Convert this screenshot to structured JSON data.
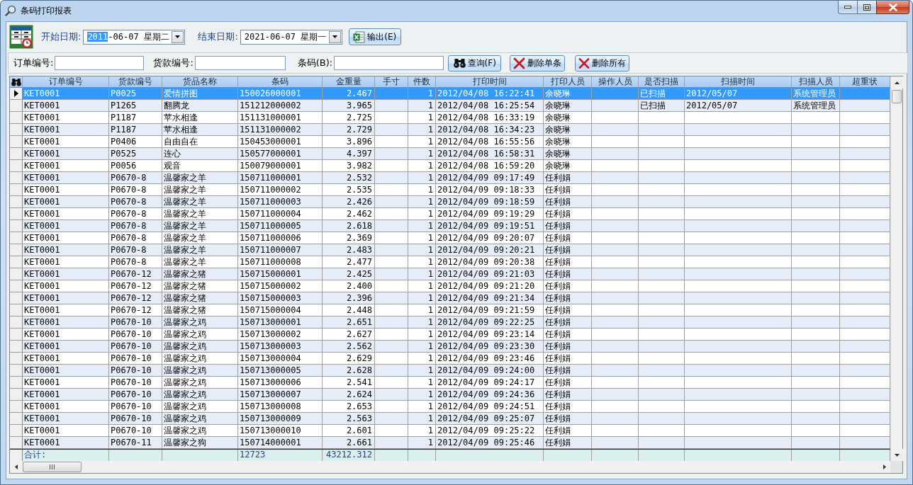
{
  "window": {
    "title": "条码打印报表"
  },
  "toolbar": {
    "start_date": {
      "label": "开始日期:",
      "year": "2011",
      "rest": "-06-07 星期二",
      "year_selected": true
    },
    "end_date": {
      "label": "结束日期:",
      "year": "2021",
      "rest": "-06-07 星期一",
      "year_selected": false
    },
    "export_button": "输出(E)"
  },
  "search": {
    "fields": [
      {
        "label": "订单编号:"
      },
      {
        "label": "货款编号:"
      },
      {
        "label": "条码(B):"
      }
    ],
    "buttons": [
      {
        "kind": "search",
        "label": "查询(F)"
      },
      {
        "kind": "delete",
        "label": "删除单条"
      },
      {
        "kind": "delete",
        "label": "删除所有"
      }
    ]
  },
  "table": {
    "columns": [
      "订单编号",
      "货款编号",
      "货品名称",
      "条码",
      "金重量",
      "手寸",
      "件数",
      "打印时间",
      "打印人员",
      "操作人员",
      "是否扫描",
      "扫描时间",
      "扫描人员",
      "超重状"
    ],
    "rows": [
      {
        "selected": true,
        "order_no": "KET0001",
        "item_no": "P0025",
        "item_name": "爱情拼图",
        "barcode": "150026000001",
        "gold_weight": "2.467",
        "qty": "1",
        "print_time": "2012/04/08 16:22:41",
        "printer": "余晓琳",
        "scanned": "已扫描",
        "scan_time": "2012/05/07",
        "scanner": "系统管理员"
      },
      {
        "selected": false,
        "order_no": "KET0001",
        "item_no": "P1265",
        "item_name": "翻腾龙",
        "barcode": "151212000002",
        "gold_weight": "3.965",
        "qty": "1",
        "print_time": "2012/04/08 16:25:54",
        "printer": "余晓琳",
        "scanned": "已扫描",
        "scan_time": "2012/05/07",
        "scanner": "系统管理员"
      },
      {
        "selected": false,
        "order_no": "KET0001",
        "item_no": "P1187",
        "item_name": "苹水相逢",
        "barcode": "151131000001",
        "gold_weight": "2.725",
        "qty": "1",
        "print_time": "2012/04/08 16:33:19",
        "printer": "余晓琳"
      },
      {
        "selected": false,
        "order_no": "KET0001",
        "item_no": "P1187",
        "item_name": "苹水相逢",
        "barcode": "151131000002",
        "gold_weight": "2.729",
        "qty": "1",
        "print_time": "2012/04/08 16:34:23",
        "printer": "余晓琳"
      },
      {
        "selected": false,
        "order_no": "KET0001",
        "item_no": "P0406",
        "item_name": "自由自在",
        "barcode": "150453000001",
        "gold_weight": "3.896",
        "qty": "1",
        "print_time": "2012/04/08 16:55:56",
        "printer": "余晓琳"
      },
      {
        "selected": false,
        "order_no": "KET0001",
        "item_no": "P0525",
        "item_name": "连心",
        "barcode": "150577000001",
        "gold_weight": "4.397",
        "qty": "1",
        "print_time": "2012/04/08 16:58:31",
        "printer": "余晓琳"
      },
      {
        "selected": false,
        "order_no": "KET0001",
        "item_no": "P0056",
        "item_name": "观音",
        "barcode": "150079000001",
        "gold_weight": "3.982",
        "qty": "1",
        "print_time": "2012/04/08 16:59:20",
        "printer": "余晓琳"
      },
      {
        "selected": false,
        "order_no": "KET0001",
        "item_no": "P0670-8",
        "item_name": "温馨家之羊",
        "barcode": "150711000001",
        "gold_weight": "2.532",
        "qty": "1",
        "print_time": "2012/04/09 09:17:49",
        "printer": "任利娟"
      },
      {
        "selected": false,
        "order_no": "KET0001",
        "item_no": "P0670-8",
        "item_name": "温馨家之羊",
        "barcode": "150711000002",
        "gold_weight": "2.535",
        "qty": "1",
        "print_time": "2012/04/09 09:18:33",
        "printer": "任利娟"
      },
      {
        "selected": false,
        "order_no": "KET0001",
        "item_no": "P0670-8",
        "item_name": "温馨家之羊",
        "barcode": "150711000003",
        "gold_weight": "2.426",
        "qty": "1",
        "print_time": "2012/04/09 09:18:59",
        "printer": "任利娟"
      },
      {
        "selected": false,
        "order_no": "KET0001",
        "item_no": "P0670-8",
        "item_name": "温馨家之羊",
        "barcode": "150711000004",
        "gold_weight": "2.462",
        "qty": "1",
        "print_time": "2012/04/09 09:19:29",
        "printer": "任利娟"
      },
      {
        "selected": false,
        "order_no": "KET0001",
        "item_no": "P0670-8",
        "item_name": "温馨家之羊",
        "barcode": "150711000005",
        "gold_weight": "2.618",
        "qty": "1",
        "print_time": "2012/04/09 09:19:51",
        "printer": "任利娟"
      },
      {
        "selected": false,
        "order_no": "KET0001",
        "item_no": "P0670-8",
        "item_name": "温馨家之羊",
        "barcode": "150711000006",
        "gold_weight": "2.369",
        "qty": "1",
        "print_time": "2012/04/09 09:20:07",
        "printer": "任利娟"
      },
      {
        "selected": false,
        "order_no": "KET0001",
        "item_no": "P0670-8",
        "item_name": "温馨家之羊",
        "barcode": "150711000007",
        "gold_weight": "2.483",
        "qty": "1",
        "print_time": "2012/04/09 09:20:21",
        "printer": "任利娟"
      },
      {
        "selected": false,
        "order_no": "KET0001",
        "item_no": "P0670-8",
        "item_name": "温馨家之羊",
        "barcode": "150711000008",
        "gold_weight": "2.477",
        "qty": "1",
        "print_time": "2012/04/09 09:20:38",
        "printer": "任利娟"
      },
      {
        "selected": false,
        "order_no": "KET0001",
        "item_no": "P0670-12",
        "item_name": "温馨家之猪",
        "barcode": "150715000001",
        "gold_weight": "2.425",
        "qty": "1",
        "print_time": "2012/04/09 09:21:03",
        "printer": "任利娟"
      },
      {
        "selected": false,
        "order_no": "KET0001",
        "item_no": "P0670-12",
        "item_name": "温馨家之猪",
        "barcode": "150715000002",
        "gold_weight": "2.400",
        "qty": "1",
        "print_time": "2012/04/09 09:21:20",
        "printer": "任利娟"
      },
      {
        "selected": false,
        "order_no": "KET0001",
        "item_no": "P0670-12",
        "item_name": "温馨家之猪",
        "barcode": "150715000003",
        "gold_weight": "2.396",
        "qty": "1",
        "print_time": "2012/04/09 09:21:34",
        "printer": "任利娟"
      },
      {
        "selected": false,
        "order_no": "KET0001",
        "item_no": "P0670-12",
        "item_name": "温馨家之猪",
        "barcode": "150715000004",
        "gold_weight": "2.448",
        "qty": "1",
        "print_time": "2012/04/09 09:21:59",
        "printer": "任利娟"
      },
      {
        "selected": false,
        "order_no": "KET0001",
        "item_no": "P0670-10",
        "item_name": "温馨家之鸡",
        "barcode": "150713000001",
        "gold_weight": "2.651",
        "qty": "1",
        "print_time": "2012/04/09 09:22:25",
        "printer": "任利娟"
      },
      {
        "selected": false,
        "order_no": "KET0001",
        "item_no": "P0670-10",
        "item_name": "温馨家之鸡",
        "barcode": "150713000002",
        "gold_weight": "2.627",
        "qty": "1",
        "print_time": "2012/04/09 09:23:14",
        "printer": "任利娟"
      },
      {
        "selected": false,
        "order_no": "KET0001",
        "item_no": "P0670-10",
        "item_name": "温馨家之鸡",
        "barcode": "150713000003",
        "gold_weight": "2.562",
        "qty": "1",
        "print_time": "2012/04/09 09:23:30",
        "printer": "任利娟"
      },
      {
        "selected": false,
        "order_no": "KET0001",
        "item_no": "P0670-10",
        "item_name": "温馨家之鸡",
        "barcode": "150713000004",
        "gold_weight": "2.629",
        "qty": "1",
        "print_time": "2012/04/09 09:23:46",
        "printer": "任利娟"
      },
      {
        "selected": false,
        "order_no": "KET0001",
        "item_no": "P0670-10",
        "item_name": "温馨家之鸡",
        "barcode": "150713000005",
        "gold_weight": "2.628",
        "qty": "1",
        "print_time": "2012/04/09 09:24:00",
        "printer": "任利娟"
      },
      {
        "selected": false,
        "order_no": "KET0001",
        "item_no": "P0670-10",
        "item_name": "温馨家之鸡",
        "barcode": "150713000006",
        "gold_weight": "2.541",
        "qty": "1",
        "print_time": "2012/04/09 09:24:17",
        "printer": "任利娟"
      },
      {
        "selected": false,
        "order_no": "KET0001",
        "item_no": "P0670-10",
        "item_name": "温馨家之鸡",
        "barcode": "150713000007",
        "gold_weight": "2.624",
        "qty": "1",
        "print_time": "2012/04/09 09:24:36",
        "printer": "任利娟"
      },
      {
        "selected": false,
        "order_no": "KET0001",
        "item_no": "P0670-10",
        "item_name": "温馨家之鸡",
        "barcode": "150713000008",
        "gold_weight": "2.653",
        "qty": "1",
        "print_time": "2012/04/09 09:24:51",
        "printer": "任利娟"
      },
      {
        "selected": false,
        "order_no": "KET0001",
        "item_no": "P0670-10",
        "item_name": "温馨家之鸡",
        "barcode": "150713000009",
        "gold_weight": "2.563",
        "qty": "1",
        "print_time": "2012/04/09 09:25:07",
        "printer": "任利娟"
      },
      {
        "selected": false,
        "order_no": "KET0001",
        "item_no": "P0670-10",
        "item_name": "温馨家之鸡",
        "barcode": "150713000010",
        "gold_weight": "2.601",
        "qty": "1",
        "print_time": "2012/04/09 09:25:22",
        "printer": "任利娟"
      },
      {
        "selected": false,
        "order_no": "KET0001",
        "item_no": "P0670-11",
        "item_name": "温馨家之狗",
        "barcode": "150714000001",
        "gold_weight": "2.661",
        "qty": "1",
        "print_time": "2012/04/09 09:25:46",
        "printer": "任利娟"
      }
    ],
    "totals": {
      "order_no": "合计:",
      "barcode": "12723",
      "gold_weight": "43212.312"
    }
  }
}
